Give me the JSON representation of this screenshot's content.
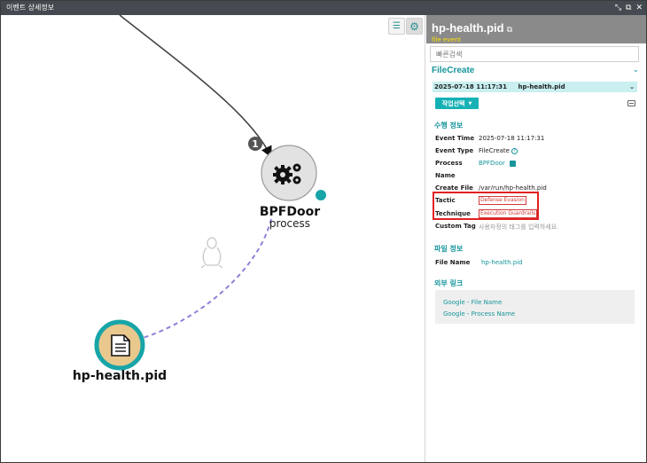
{
  "window": {
    "title": "이벤트 상세정보",
    "controls": [
      "⤡",
      "⧉",
      "✕"
    ]
  },
  "graph": {
    "edge_badge": "1",
    "process_node": {
      "name": "BPFDoor",
      "type": "process"
    },
    "file_node": {
      "name": "hp-health.pid"
    },
    "toolbar": {
      "list_icon": "list-view-icon",
      "settings_icon": "gear-icon"
    },
    "colors": {
      "teal": "#17a5a8",
      "node_gray": "#e2e2e2",
      "file_fill": "#e9c88e",
      "dashed_edge": "#8c83d8"
    }
  },
  "panel": {
    "title": "hp-health.pid",
    "subtitle": "file event",
    "search_placeholder": "빠른검색",
    "event_type": "FileCreate",
    "selected_event": {
      "time": "2025-07-18 11:17:31",
      "name": "hp-health.pid"
    },
    "action_button": "작업선택",
    "execution_info": {
      "title": "수행 정보",
      "rows": [
        {
          "label": "Event Time",
          "value": "2025-07-18 11:17:31"
        },
        {
          "label": "Event Type",
          "value": "FileCreate"
        },
        {
          "label": "Process",
          "value": "BPFDoor"
        },
        {
          "label": "Name",
          "value": ""
        },
        {
          "label": "Create File",
          "value": "/var/run/hp-health.pid"
        },
        {
          "label": "Tactic",
          "value": "Defense Evasion"
        },
        {
          "label": "Technique",
          "value": "Execution Guardrails"
        },
        {
          "label": "Custom Tag",
          "value": "사용자정의 태그를 입력하세요."
        }
      ]
    },
    "file_info": {
      "title": "파일 정보",
      "rows": [
        {
          "label": "File Name",
          "value": "hp-health.pid"
        }
      ]
    },
    "external_links": {
      "title": "외부 링크",
      "links": [
        "Google - File Name",
        "Google - Process Name"
      ]
    }
  }
}
